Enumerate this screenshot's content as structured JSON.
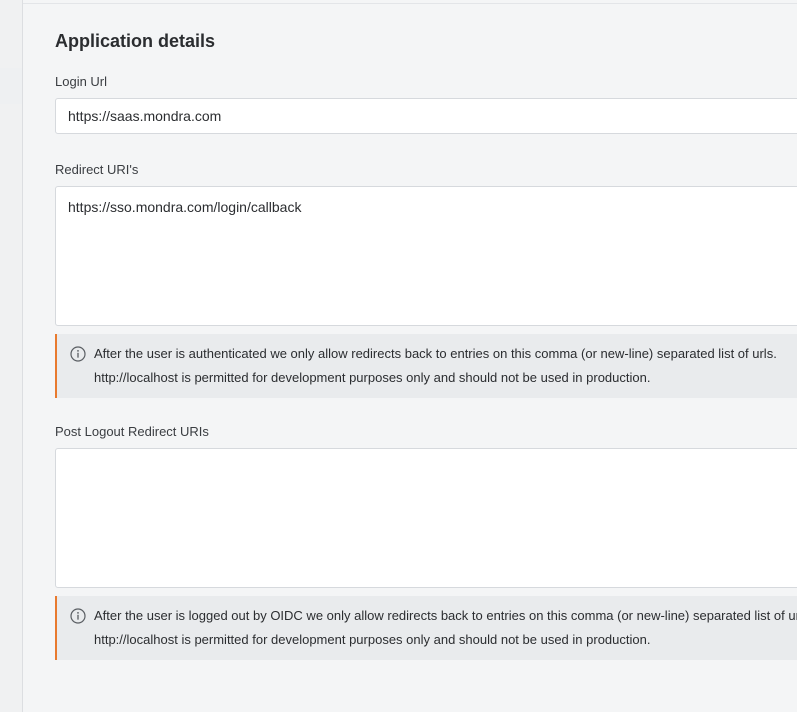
{
  "section": {
    "title": "Application details"
  },
  "login_url": {
    "label": "Login Url",
    "value": "https://saas.mondra.com"
  },
  "redirect_uris": {
    "label": "Redirect URI's",
    "value": "https://sso.mondra.com/login/callback",
    "info_line1": "After the user is authenticated we only allow redirects back to entries on this comma (or new-line) separated list of urls.",
    "info_line2": "http://localhost is permitted for development purposes only and should not be used in production."
  },
  "post_logout_redirect_uris": {
    "label": "Post Logout Redirect URIs",
    "value": "",
    "info_line1": "After the user is logged out by OIDC we only allow redirects back to entries on this comma (or new-line) separated list of urls.",
    "info_line2": "http://localhost is permitted for development purposes only and should not be used in production."
  },
  "icons": {
    "info": "info-circle-icon"
  },
  "colors": {
    "info_accent": "#e87a2e",
    "info_background": "#e9ebed",
    "page_background": "#f4f5f6"
  }
}
